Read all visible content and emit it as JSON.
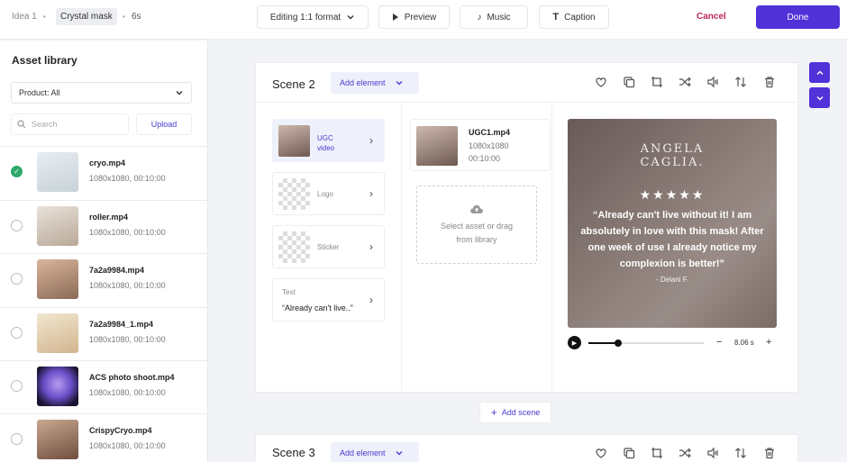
{
  "topbar": {
    "breadcrumbs": [
      "Idea 1",
      "Crystal mask",
      "6s"
    ],
    "format_label": "Editing 1:1 format",
    "preview_label": "Preview",
    "music_label": "Music",
    "caption_label": "Caption",
    "cancel_label": "Cancel",
    "done_label": "Done"
  },
  "sidebar": {
    "title": "Asset library",
    "product_filter": "Product: All",
    "search_placeholder": "Search",
    "upload_label": "Upload",
    "assets": [
      {
        "name": "cryo.mp4",
        "meta": "1080x1080, 00:10:00",
        "selected": true
      },
      {
        "name": "roller.mp4",
        "meta": "1080x1080, 00:10:00",
        "selected": false
      },
      {
        "name": "7a2a9984.mp4",
        "meta": "1080x1080, 00:10:00",
        "selected": false
      },
      {
        "name": "7a2a9984_1.mp4",
        "meta": "1080x1080, 00:10:00",
        "selected": false
      },
      {
        "name": "ACS photo shoot.mp4",
        "meta": "1080x1080, 00:10:00",
        "selected": false
      },
      {
        "name": "CrispyCryo.mp4",
        "meta": "1080x1080, 00:10:00",
        "selected": false
      }
    ]
  },
  "scene2": {
    "title": "Scene 2",
    "add_element_label": "Add element",
    "elements": [
      {
        "label": "UGC video"
      },
      {
        "label": "Logo"
      },
      {
        "label": "Sticker"
      },
      {
        "label": "Text",
        "value": "“Already can't live..”"
      }
    ],
    "file": {
      "name": "UGC1.mp4",
      "resolution": "1080x1080",
      "duration": "00:10:00"
    },
    "drop_zone_text": "Select asset or drag from library",
    "preview": {
      "brand": "ANGELA CAGLIA.",
      "stars": "★★★★★",
      "quote": "“Already can't live without it! I am absolutely in love with this mask! After one week of use I already notice my complexion is better!”",
      "author": "- Delani F."
    },
    "player": {
      "duration": "8.06 s",
      "progress": 0.26
    }
  },
  "add_scene_label": "Add scene",
  "scene3": {
    "title": "Scene 3",
    "add_element_label": "Add element"
  },
  "colors": {
    "accent": "#5131d8",
    "cancel": "#c0265a",
    "selected": "#2fa86a"
  }
}
